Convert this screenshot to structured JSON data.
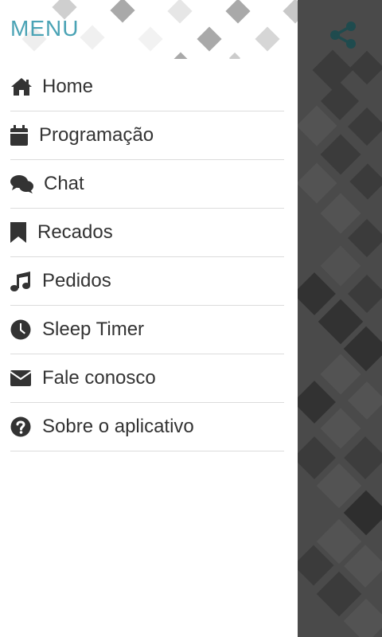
{
  "drawer": {
    "title": "MENU",
    "items": [
      {
        "label": "Home",
        "icon": "home-icon"
      },
      {
        "label": "Programação",
        "icon": "calendar-icon"
      },
      {
        "label": "Chat",
        "icon": "chat-icon"
      },
      {
        "label": "Recados",
        "icon": "bookmark-icon"
      },
      {
        "label": "Pedidos",
        "icon": "music-note-icon"
      },
      {
        "label": "Sleep Timer",
        "icon": "clock-icon"
      },
      {
        "label": "Fale conosco",
        "icon": "envelope-icon"
      },
      {
        "label": "Sobre o aplicativo",
        "icon": "question-circle-icon"
      }
    ]
  },
  "header": {
    "share_icon": "share-icon"
  },
  "colors": {
    "accent": "#4aa3b5",
    "icon": "#333333",
    "background": "#4a4a4a",
    "divider": "#dcdcdc"
  }
}
